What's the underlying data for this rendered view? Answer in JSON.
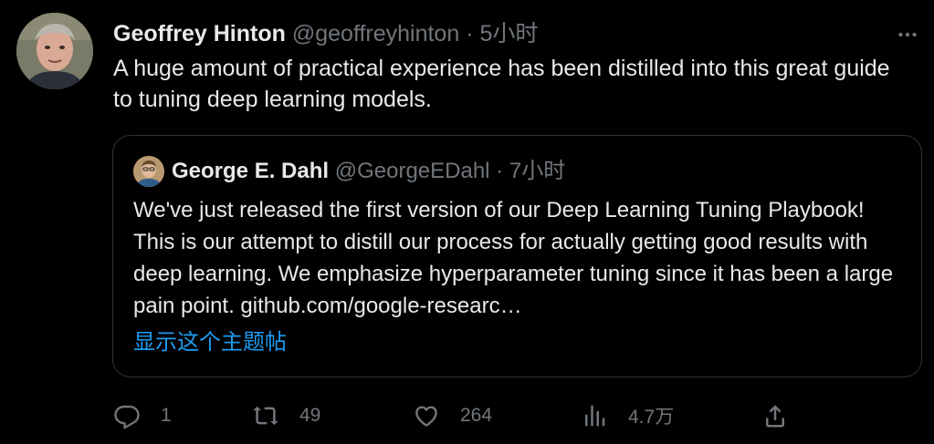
{
  "tweet": {
    "author_name": "Geoffrey Hinton",
    "author_handle": "@geoffreyhinton",
    "separator": "·",
    "time": "5小时",
    "text": "A huge amount of practical experience has been distilled into this great guide to tuning deep learning models."
  },
  "quoted_tweet": {
    "author_name": "George E. Dahl",
    "author_handle": "@GeorgeEDahl",
    "separator": "·",
    "time": "7小时",
    "text": "We've just released the first version of our Deep Learning Tuning Playbook! This is our attempt to distill our process for actually getting good results with deep learning. We emphasize hyperparameter tuning since it has been a large pain point. github.com/google-researc…",
    "show_thread_label": "显示这个主题帖"
  },
  "actions": {
    "reply_count": "1",
    "retweet_count": "49",
    "like_count": "264",
    "views_count": "4.7万"
  },
  "icons": {
    "more": "more-horizontal-icon",
    "reply": "reply-icon",
    "retweet": "retweet-icon",
    "like": "heart-icon",
    "views": "analytics-icon",
    "share": "share-icon"
  },
  "colors": {
    "background": "#000000",
    "text_primary": "#e7e9ea",
    "text_secondary": "#71767b",
    "link": "#1d9bf0",
    "border": "#2f3336"
  }
}
